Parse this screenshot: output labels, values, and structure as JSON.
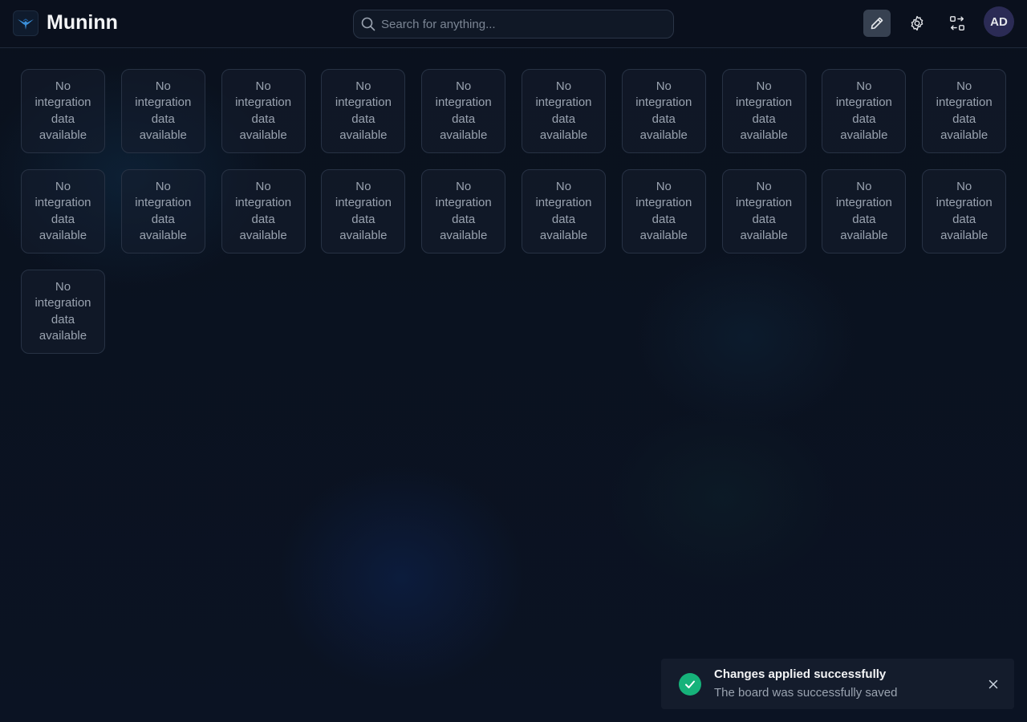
{
  "header": {
    "app_title": "Muninn",
    "search_placeholder": "Search for anything...",
    "avatar_initials": "AD",
    "buttons": [
      "edit-icon",
      "gear-icon",
      "swap-icon"
    ]
  },
  "cards": [
    {
      "message": "No integration data available"
    },
    {
      "message": "No integration data available"
    },
    {
      "message": "No integration data available"
    },
    {
      "message": "No integration data available"
    },
    {
      "message": "No integration data available"
    },
    {
      "message": "No integration data available"
    },
    {
      "message": "No integration data available"
    },
    {
      "message": "No integration data available"
    },
    {
      "message": "No integration data available"
    },
    {
      "message": "No integration data available"
    },
    {
      "message": "No integration data available"
    },
    {
      "message": "No integration data available"
    },
    {
      "message": "No integration data available"
    },
    {
      "message": "No integration data available"
    },
    {
      "message": "No integration data available"
    },
    {
      "message": "No integration data available"
    },
    {
      "message": "No integration data available"
    },
    {
      "message": "No integration data available"
    },
    {
      "message": "No integration data available"
    },
    {
      "message": "No integration data available"
    },
    {
      "message": "No integration data available"
    }
  ],
  "toast": {
    "title": "Changes applied successfully",
    "message": "The board was successfully saved",
    "status_color": "#16b27a"
  },
  "colors": {
    "background": "#0b1120",
    "accent": "#16b27a",
    "avatar": "#2b2b55"
  }
}
